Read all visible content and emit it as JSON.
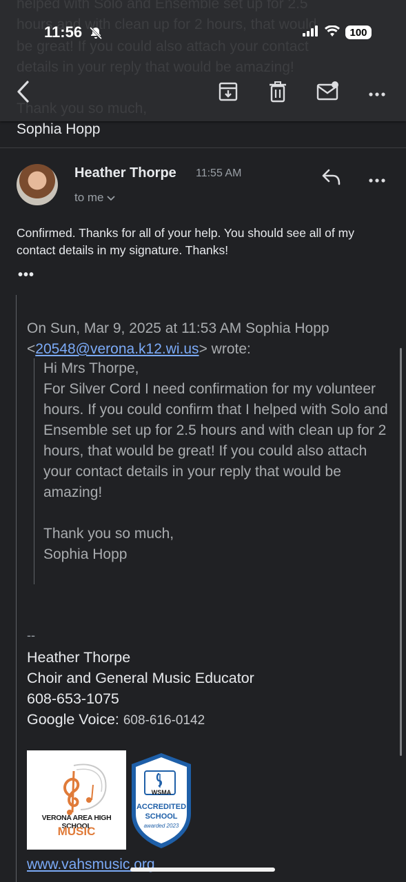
{
  "status_bar": {
    "time": "11:56",
    "battery": "100"
  },
  "ghost_lines": [
    "helped with Solo and Ensemble set up for 2.5",
    "hours and with clean up for 2 hours, that would",
    "be great! If you could also attach your contact",
    "details in your reply that would be amazing!",
    "Thank you so much,"
  ],
  "previous_signoff": "Sophia Hopp",
  "message": {
    "sender": "Heather Thorpe",
    "time": "11:55 AM",
    "recipient": "to me",
    "body": "Confirmed.  Thanks for all of your help.  You should see all of my contact details in my signature.  Thanks!",
    "more": "•••"
  },
  "quote": {
    "header_prefix": "On Sun, Mar 9, 2025 at 11:53 AM Sophia Hopp <",
    "email": "20548@verona.k12.wi.us",
    "header_suffix": "> wrote:",
    "greeting": "Hi Mrs Thorpe,",
    "paragraph": "For Silver Cord I need confirmation for my volunteer hours. If you could confirm that I helped with Solo and Ensemble set up for 2.5 hours and with clean up for 2 hours, that would be great! If you could also attach your contact details in your reply that would be amazing!",
    "closing": "Thank you so much,",
    "name": "Sophia Hopp"
  },
  "signature": {
    "dashes": "--",
    "name": "Heather Thorpe",
    "title": "Choir and General Music Educator",
    "phone": "608-653-1075",
    "gv_label": "Google Voice:",
    "gv_number": "608-616-0142",
    "logo_line1": "VERONA AREA HIGH SCHOOL",
    "logo_line2": "MUSIC",
    "badge_org": "WSMA",
    "badge_line1": "ACCREDITED",
    "badge_line2": "SCHOOL",
    "badge_line3": "awarded 2023",
    "website": "www.vahsmusic.org"
  },
  "icons": [
    "back-icon",
    "archive-icon",
    "delete-icon",
    "mark-unread-icon",
    "more-icon",
    "reply-icon",
    "bell-off-icon"
  ]
}
